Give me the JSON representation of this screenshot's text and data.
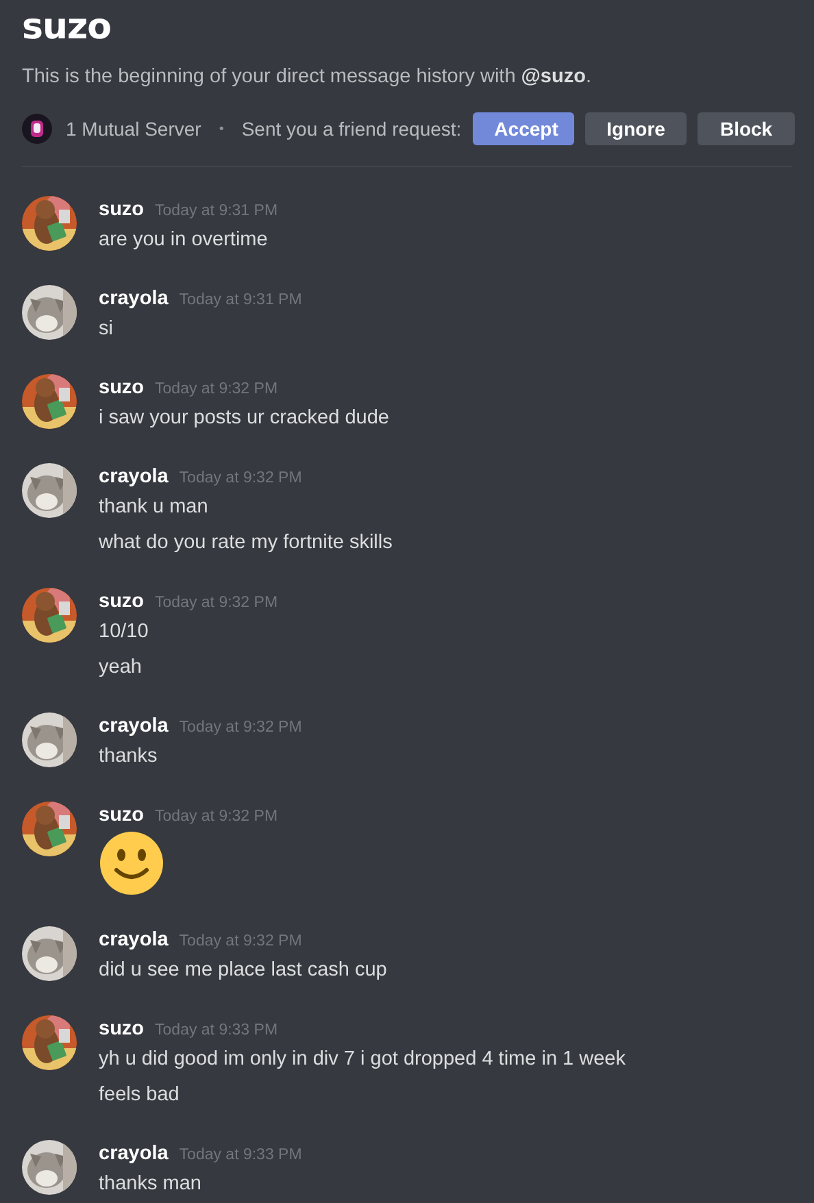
{
  "header": {
    "title": "suzo",
    "intro": "This is the beginning of your direct message history with **@suzo**.",
    "mutual": "1 Mutual Server",
    "separator": "•",
    "request": "Sent you a friend request:",
    "buttons": [
      {
        "label": "Accept",
        "kind": "primary"
      },
      {
        "label": "Ignore",
        "kind": "secondary"
      },
      {
        "label": "Block",
        "kind": "secondary"
      }
    ]
  },
  "groups": [
    {
      "author": "suzo",
      "timestamp": "Today at 9:31 PM",
      "messages": [
        {
          "kind": "text",
          "text": "are you in overtime"
        }
      ]
    },
    {
      "author": "crayola",
      "timestamp": "Today at 9:31 PM",
      "messages": [
        {
          "kind": "text",
          "text": "si"
        }
      ]
    },
    {
      "author": "suzo",
      "timestamp": "Today at 9:32 PM",
      "messages": [
        {
          "kind": "text",
          "text": "i saw your posts ur cracked dude"
        }
      ]
    },
    {
      "author": "crayola",
      "timestamp": "Today at 9:32 PM",
      "messages": [
        {
          "kind": "text",
          "text": "thank u man"
        },
        {
          "kind": "text",
          "text": "what do you rate my fortnite skills"
        }
      ]
    },
    {
      "author": "suzo",
      "timestamp": "Today at 9:32 PM",
      "messages": [
        {
          "kind": "text",
          "text": "10/10"
        },
        {
          "kind": "text",
          "text": "yeah"
        }
      ]
    },
    {
      "author": "crayola",
      "timestamp": "Today at 9:32 PM",
      "messages": [
        {
          "kind": "text",
          "text": "thanks"
        }
      ]
    },
    {
      "author": "suzo",
      "timestamp": "Today at 9:32 PM",
      "messages": [
        {
          "kind": "emoji"
        }
      ]
    },
    {
      "author": "crayola",
      "timestamp": "Today at 9:32 PM",
      "messages": [
        {
          "kind": "text",
          "text": "did u see me place last cash cup"
        }
      ]
    },
    {
      "author": "suzo",
      "timestamp": "Today at 9:33 PM",
      "messages": [
        {
          "kind": "text",
          "text": "yh u did good im only in div 7 i got dropped 4 time in 1 week"
        },
        {
          "kind": "text",
          "text": "feels bad"
        }
      ]
    },
    {
      "author": "crayola",
      "timestamp": "Today at 9:33 PM",
      "messages": [
        {
          "kind": "text",
          "text": "thanks man"
        }
      ]
    }
  ]
}
